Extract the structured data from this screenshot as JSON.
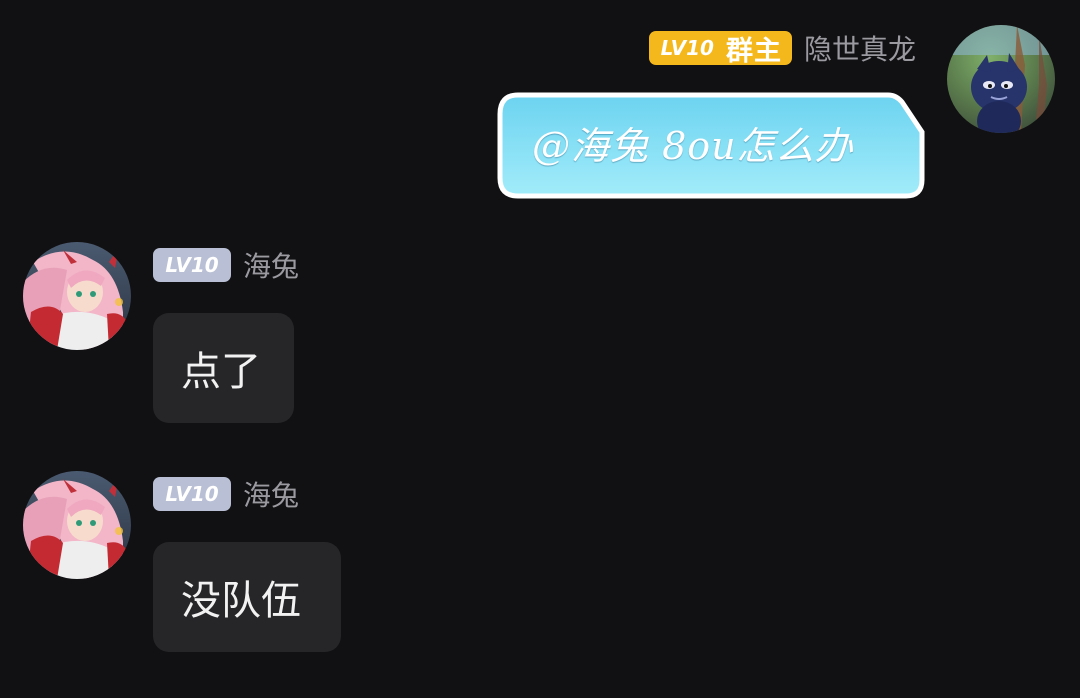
{
  "messages": [
    {
      "side": "right",
      "level": "LV10",
      "role": "群主",
      "username": "隐世真龙",
      "text": "@海兔 8ou怎么办",
      "avatar_icon": "blue-creature-avatar"
    },
    {
      "side": "left",
      "level": "LV10",
      "username": "海兔",
      "text": "点了",
      "avatar_icon": "anime-girl-avatar"
    },
    {
      "side": "left",
      "level": "LV10",
      "username": "海兔",
      "text": "没队伍",
      "avatar_icon": "anime-girl-avatar"
    }
  ],
  "colors": {
    "background": "#111113",
    "bubble": "#262629",
    "owner_badge": "#f5b81c",
    "level_badge": "#b9bfd4",
    "fancy_bubble_top": "#6fd6f2",
    "fancy_bubble_bottom": "#9ae8f8"
  }
}
